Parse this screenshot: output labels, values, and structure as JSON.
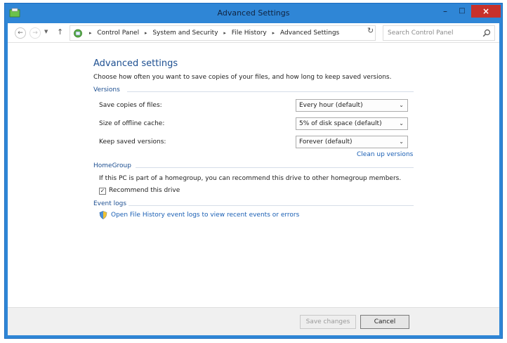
{
  "window": {
    "title": "Advanced Settings",
    "close_glyph": "×",
    "min_glyph": "–",
    "max_glyph": "□"
  },
  "address": {
    "crumbs": [
      "Control Panel",
      "System and Security",
      "File History",
      "Advanced Settings"
    ],
    "search_placeholder": "Search Control Panel"
  },
  "page": {
    "title": "Advanced settings",
    "description": "Choose how often you want to save copies of your files, and how long to keep saved versions."
  },
  "versions": {
    "heading": "Versions",
    "rows": [
      {
        "label": "Save copies of files:",
        "value": "Every hour (default)"
      },
      {
        "label": "Size of offline cache:",
        "value": "5% of disk space (default)"
      },
      {
        "label": "Keep saved versions:",
        "value": "Forever (default)"
      }
    ],
    "cleanup_link": "Clean up versions"
  },
  "homegroup": {
    "heading": "HomeGroup",
    "text": "If this PC is part of a homegroup, you can recommend this drive to other homegroup members.",
    "checkbox_label": "Recommend this drive",
    "checked": true
  },
  "eventlogs": {
    "heading": "Event logs",
    "link": "Open File History event logs to view recent events or errors"
  },
  "footer": {
    "save_label": "Save changes",
    "cancel_label": "Cancel"
  }
}
